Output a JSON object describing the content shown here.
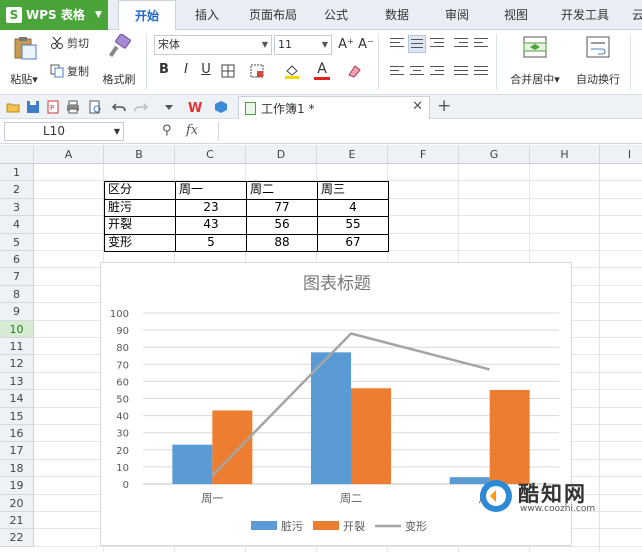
{
  "app": {
    "name": "WPS 表格",
    "logo_letter": "S"
  },
  "ribbon_tabs": [
    "开始",
    "插入",
    "页面布局",
    "公式",
    "数据",
    "审阅",
    "视图",
    "开发工具",
    "云"
  ],
  "active_tab": "开始",
  "ribbon": {
    "paste": "粘贴",
    "cut": "剪切",
    "copy": "复制",
    "format_painter": "格式刷",
    "font_name": "宋体",
    "font_size": "11",
    "bold": "B",
    "italic": "I",
    "underline": "U",
    "font_color_glyph": "A",
    "merge_center": "合并居中",
    "wrap_text": "自动换行",
    "grow_font": "A⁺",
    "shrink_font": "A⁻"
  },
  "document": {
    "tab_title": "工作簿1 *"
  },
  "formula_bar": {
    "name_box": "L10",
    "fx": "fx",
    "formula": ""
  },
  "columns": [
    "A",
    "B",
    "C",
    "D",
    "E",
    "F",
    "G",
    "H",
    "I"
  ],
  "rows": [
    "1",
    "2",
    "3",
    "4",
    "5",
    "6",
    "7",
    "8",
    "9",
    "10",
    "11",
    "12",
    "13",
    "14",
    "15",
    "16",
    "17",
    "18",
    "19",
    "20",
    "21",
    "22"
  ],
  "selected_row": "10",
  "table": {
    "headers": [
      "区分",
      "周一",
      "周二",
      "周三"
    ],
    "rows": [
      {
        "label": "脏污",
        "values": [
          "23",
          "77",
          "4"
        ]
      },
      {
        "label": "开裂",
        "values": [
          "43",
          "56",
          "55"
        ]
      },
      {
        "label": "变形",
        "values": [
          "5",
          "88",
          "67"
        ]
      }
    ]
  },
  "chart_data": {
    "type": "bar",
    "title": "图表标题",
    "categories": [
      "周一",
      "周二",
      "周三"
    ],
    "series": [
      {
        "name": "脏污",
        "values": [
          23,
          77,
          4
        ],
        "type": "bar",
        "color": "#5b9bd5"
      },
      {
        "name": "开裂",
        "values": [
          43,
          56,
          55
        ],
        "type": "bar",
        "color": "#ed7d31"
      },
      {
        "name": "变形",
        "values": [
          5,
          88,
          67
        ],
        "type": "line",
        "color": "#a5a5a5"
      }
    ],
    "ylim": [
      0,
      100
    ],
    "yticks": [
      0,
      10,
      20,
      30,
      40,
      50,
      60,
      70,
      80,
      90,
      100
    ],
    "grid": true,
    "legend_position": "bottom"
  },
  "colors": {
    "accent_green": "#4aa43a",
    "tab_active": "#1e66c9"
  },
  "watermark": {
    "text": "酷知网",
    "url": "www.coozhi.com"
  }
}
